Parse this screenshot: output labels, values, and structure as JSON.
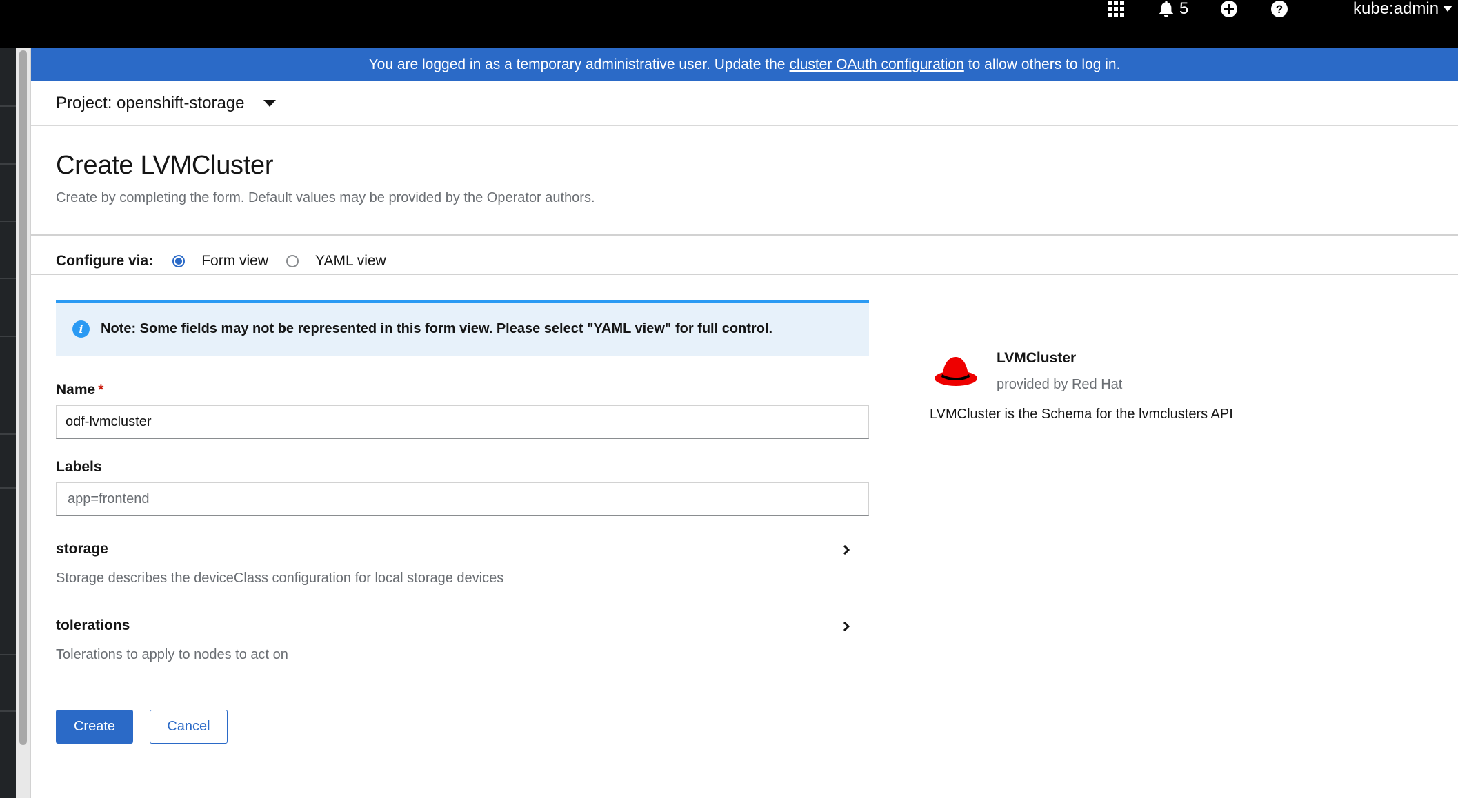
{
  "masthead": {
    "apps_icon": "grid-icon",
    "notifications": {
      "icon": "bell-icon",
      "count": "5"
    },
    "add_icon": "plus-circle-icon",
    "help_icon": "question-circle-icon",
    "user": {
      "label": "kube:admin",
      "icon": "caret-down-icon"
    }
  },
  "banner": {
    "text_before": "You are logged in as a temporary administrative user. Update the",
    "link": "cluster OAuth configuration",
    "text_after": "to allow others to log in.",
    "color": "#2b6ac7"
  },
  "project": {
    "label": "Project: openshift-storage",
    "icon": "caret-down-icon"
  },
  "page": {
    "title": "Create LVMCluster",
    "subtitle": "Create by completing the form. Default values may be provided by the Operator authors."
  },
  "configure": {
    "label": "Configure via:",
    "options": [
      {
        "label": "Form view",
        "selected": true
      },
      {
        "label": "YAML view",
        "selected": false
      }
    ]
  },
  "form": {
    "alert": {
      "icon": "info-circle-icon",
      "text": "Note: Some fields may not be represented in this form view. Please select \"YAML view\" for full control."
    },
    "name": {
      "label": "Name",
      "required_marker": "*",
      "value": "odf-lvmcluster"
    },
    "labels": {
      "label": "Labels",
      "placeholder": "app=frontend"
    },
    "storage": {
      "title": "storage",
      "description": "Storage describes the deviceClass configuration for local storage devices",
      "icon": "chevron-right-icon"
    },
    "tolerations": {
      "title": "tolerations",
      "description": "Tolerations to apply to nodes to act on",
      "icon": "chevron-right-icon"
    },
    "create_button": "Create",
    "cancel_button": "Cancel"
  },
  "side_panel": {
    "logo": "redhat-hat-icon",
    "title": "LVMCluster",
    "provider": "provided by Red Hat",
    "description": "LVMCluster is the Schema for the lvmclusters API"
  },
  "colors": {
    "primary": "#2b6ac7",
    "alert_bg": "#e7f1fa",
    "required": "#c9190b",
    "redhat": "#ee0000"
  }
}
